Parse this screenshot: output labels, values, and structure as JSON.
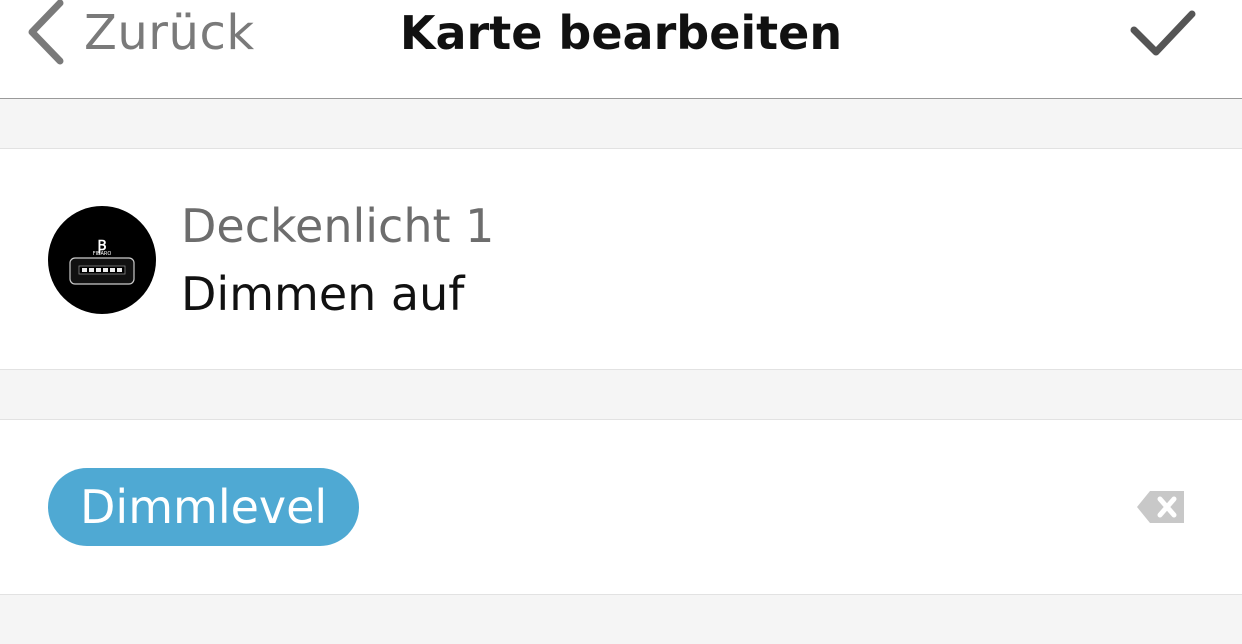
{
  "navbar": {
    "back_label": "Zurück",
    "title": "Karte bearbeiten",
    "back_icon": "chevron-left-icon",
    "confirm_icon": "checkmark-icon"
  },
  "card": {
    "device_name": "Deckenlicht 1",
    "action": "Dimmen auf",
    "avatar_icon": "fibaro-dimmer-device-icon"
  },
  "parameter": {
    "tag_label": "Dimmlevel",
    "delete_icon": "backspace-delete-icon"
  },
  "colors": {
    "tag_background": "#4fa9d3",
    "background": "#f5f5f5",
    "back_label": "#7a7a7a"
  }
}
